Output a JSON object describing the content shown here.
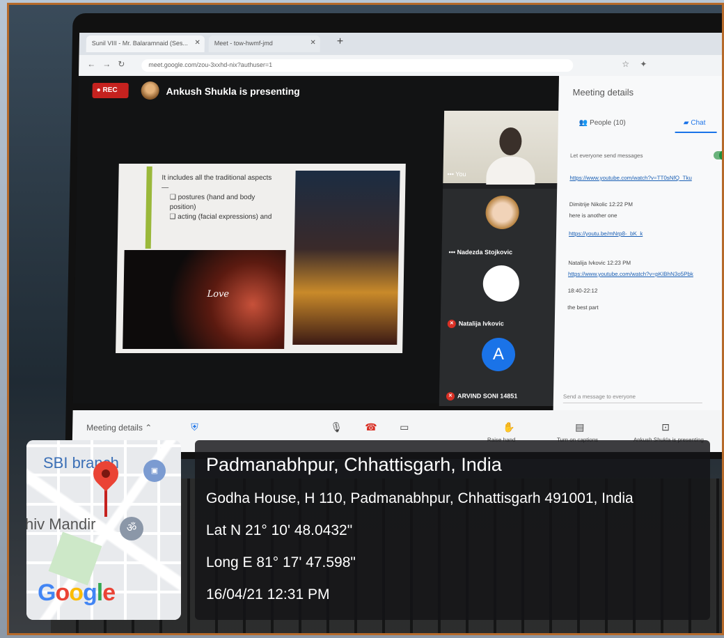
{
  "browser": {
    "tab1_label": "Sunil VIII - Mr. Balaramnaid (Ses...",
    "tab2_label": "Meet - tow-hwmf-jmd",
    "url": "meet.google.com/zou-3xxhd-nix?authuser=1"
  },
  "meet": {
    "rec_label": "REC",
    "presenting_text": "Ankush Shukla is presenting",
    "slide": {
      "line1": "It includes all the traditional aspects—",
      "bullet1": "postures (hand and body position)",
      "bullet2": "acting (facial expressions) and",
      "love_text": "Love"
    },
    "participants": [
      {
        "name": "You"
      },
      {
        "name": "Nadezda Stojkovic"
      },
      {
        "name": "Natalija Ivkovic"
      },
      {
        "name": "ARVIND SONI 14851",
        "avatar_letter": "A"
      }
    ],
    "controls": {
      "meeting_details": "Meeting details",
      "raise_hand": "Raise hand",
      "captions": "Turn on captions",
      "presenting": "Ankush Shukla is presenting"
    }
  },
  "panel": {
    "title": "Meeting details",
    "tab_people": "People (10)",
    "tab_chat": "Chat",
    "allow_messages": "Let everyone send messages",
    "messages": [
      {
        "text": "https://www.youtube.com/watch?v=TT0sNfQ_Tku",
        "link": true
      },
      {
        "text": "Dimitrije Nikolic  12:22 PM",
        "link": false
      },
      {
        "text": "here is another one",
        "link": false
      },
      {
        "text": "https://youtu.be/mNrp8-_bK_k",
        "link": true
      },
      {
        "text": "Natalija Ivkovic  12:23 PM",
        "link": false
      },
      {
        "text": "https://www.youtube.com/watch?v=pKIBhN3o5Pbk",
        "link": true
      },
      {
        "text": "18:40-22:12",
        "link": false
      },
      {
        "text": "the best part",
        "link": false
      }
    ],
    "input_placeholder": "Send a message to everyone"
  },
  "overlay": {
    "map_sbi": "SBI branch",
    "map_mandir": "hiv Mandir",
    "map_google": "Google",
    "location_title": "Padmanabhpur, Chhattisgarh, India",
    "address": "Godha House, H 110, Padmanabhpur, Chhattisgarh 491001, India",
    "lat": "Lat N 21° 10' 48.0432\"",
    "long": "Long E 81° 17' 47.598\"",
    "datetime": "16/04/21 12:31 PM"
  }
}
